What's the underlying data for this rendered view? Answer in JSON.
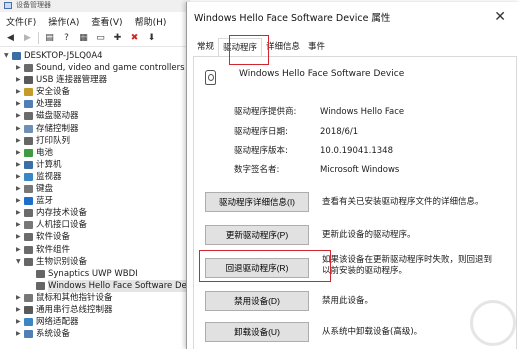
{
  "device_manager": {
    "title": "设备管理器",
    "menu": [
      "文件(F)",
      "操作(A)",
      "查看(V)",
      "帮助(H)"
    ],
    "toolbar_icons": [
      "back-icon",
      "forward-icon",
      "properties-icon",
      "help-icon",
      "update-driver-icon",
      "monitor-icon",
      "add-icon",
      "remove-icon",
      "download-icon"
    ],
    "tree": [
      {
        "label": "DESKTOP-J5LQ0A4",
        "level": 0,
        "expanded": true,
        "icon": "computer-icon",
        "color": "#3a6ea5"
      },
      {
        "label": "Sound, video and game controllers",
        "level": 1,
        "icon": "speaker-icon",
        "color": "#6a6a6a"
      },
      {
        "label": "USB 连接器管理器",
        "level": 1,
        "icon": "usb-icon",
        "color": "#5a5a5a"
      },
      {
        "label": "安全设备",
        "level": 1,
        "icon": "shield-icon",
        "color": "#c59a2a"
      },
      {
        "label": "处理器",
        "level": 1,
        "icon": "chip-icon",
        "color": "#4f7fb5"
      },
      {
        "label": "磁盘驱动器",
        "level": 1,
        "icon": "disk-icon",
        "color": "#6b6b6b"
      },
      {
        "label": "存储控制器",
        "level": 1,
        "icon": "storage-icon",
        "color": "#6f8fb7"
      },
      {
        "label": "打印队列",
        "level": 1,
        "icon": "printer-icon",
        "color": "#666666"
      },
      {
        "label": "电池",
        "level": 1,
        "icon": "battery-icon",
        "color": "#3f9b3f"
      },
      {
        "label": "计算机",
        "level": 1,
        "icon": "computer-icon",
        "color": "#3a6ea5"
      },
      {
        "label": "监视器",
        "level": 1,
        "icon": "monitor-icon",
        "color": "#3a86c5"
      },
      {
        "label": "键盘",
        "level": 1,
        "icon": "keyboard-icon",
        "color": "#777777"
      },
      {
        "label": "蓝牙",
        "level": 1,
        "icon": "bluetooth-icon",
        "color": "#1d6fc9"
      },
      {
        "label": "内存技术设备",
        "level": 1,
        "icon": "memory-icon",
        "color": "#6b6b6b"
      },
      {
        "label": "人机接口设备",
        "level": 1,
        "icon": "hid-icon",
        "color": "#777777"
      },
      {
        "label": "软件设备",
        "level": 1,
        "icon": "software-device-icon",
        "color": "#6b6b6b"
      },
      {
        "label": "软件组件",
        "level": 1,
        "icon": "component-icon",
        "color": "#6b6b6b"
      },
      {
        "label": "生物识别设备",
        "level": 1,
        "expanded": true,
        "icon": "biometric-icon",
        "color": "#666666"
      },
      {
        "label": "Synaptics UWP WBDI",
        "level": 2,
        "icon": "fingerprint-icon",
        "color": "#666666"
      },
      {
        "label": "Windows Hello Face Software Device",
        "level": 2,
        "icon": "fingerprint-icon",
        "color": "#666666",
        "selected": true
      },
      {
        "label": "鼠标和其他指针设备",
        "level": 1,
        "icon": "mouse-icon",
        "color": "#777777"
      },
      {
        "label": "通用串行总线控制器",
        "level": 1,
        "icon": "usb-icon",
        "color": "#5a5a5a"
      },
      {
        "label": "网络适配器",
        "level": 1,
        "icon": "network-icon",
        "color": "#3a86c5"
      },
      {
        "label": "系统设备",
        "level": 1,
        "icon": "system-icon",
        "color": "#4f7fb5"
      }
    ]
  },
  "dialog": {
    "title": "Windows Hello Face Software Device 属性",
    "tabs": [
      "常规",
      "驱动程序",
      "详细信息",
      "事件"
    ],
    "active_tab": "驱动程序",
    "device_name": "Windows Hello Face Software Device",
    "info": [
      {
        "key": "驱动程序提供商:",
        "value": "Windows Hello Face"
      },
      {
        "key": "驱动程序日期:",
        "value": "2018/6/1"
      },
      {
        "key": "驱动程序版本:",
        "value": "10.0.19041.1348"
      },
      {
        "key": "数字签名者:",
        "value": "Microsoft Windows"
      }
    ],
    "buttons": [
      {
        "label": "驱动程序详细信息(I)",
        "desc": [
          "查看有关已安装驱动程序文件的详细信息。"
        ]
      },
      {
        "label": "更新驱动程序(P)",
        "desc": [
          "更新此设备的驱动程序。"
        ]
      },
      {
        "label": "回退驱动程序(R)",
        "desc": [
          "如果该设备在更新驱动程序时失败，则回退到",
          "以前安装的驱动程序。"
        ]
      },
      {
        "label": "禁用设备(D)",
        "desc": [
          "禁用此设备。"
        ]
      },
      {
        "label": "卸载设备(U)",
        "desc": [
          "从系统中卸载设备(高级)。"
        ]
      }
    ],
    "highlight_color": "#d0262f"
  }
}
